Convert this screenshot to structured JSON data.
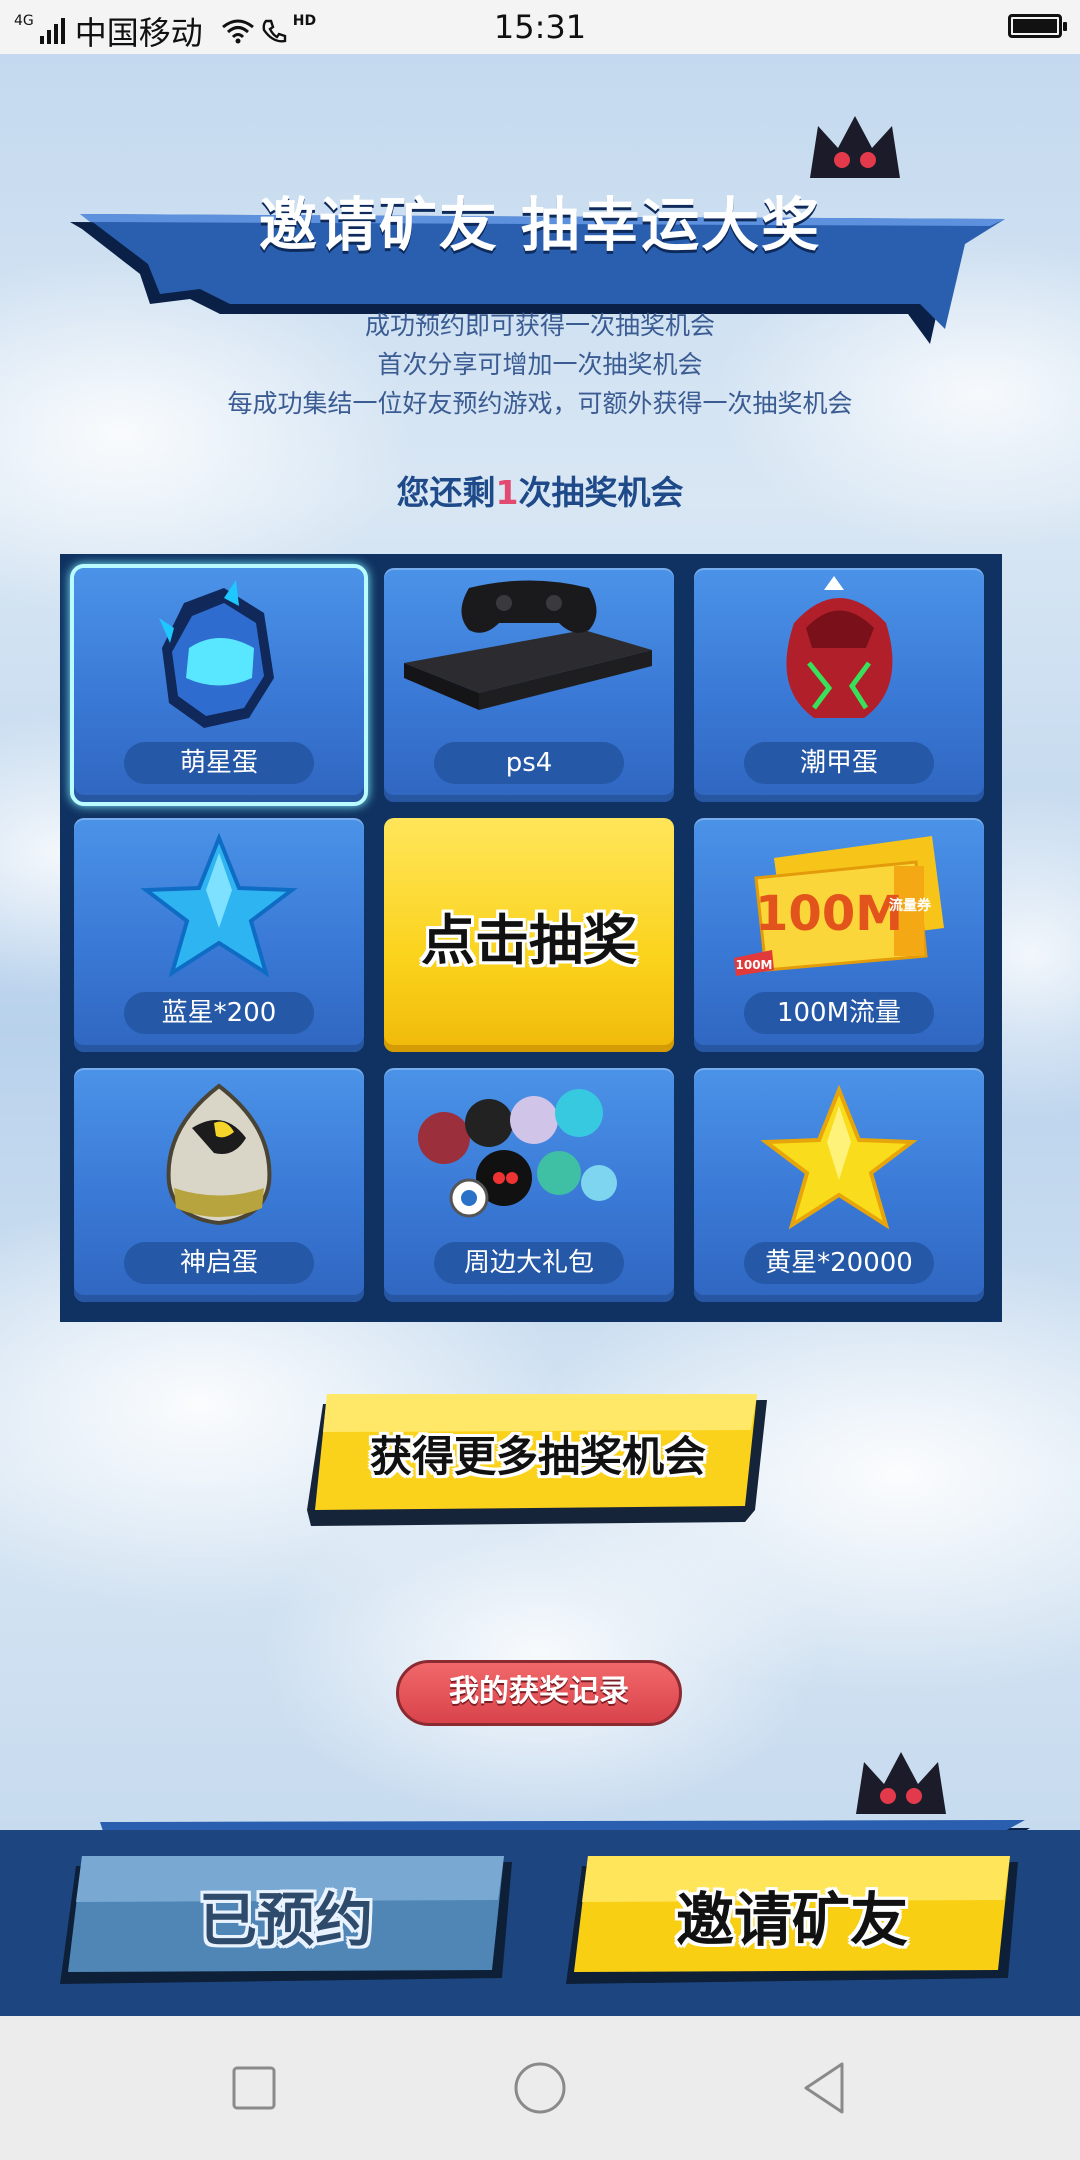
{
  "status_bar": {
    "network": "4G",
    "carrier": "中国移动",
    "hd": "HD",
    "time": "15:31"
  },
  "page": {
    "title": "邀请矿友 抽幸运大奖",
    "intro": [
      "成功预约即可获得一次抽奖机会",
      "首次分享可增加一次抽奖机会",
      "每成功集结一位好友预约游戏，可额外获得一次抽奖机会"
    ],
    "chances_prefix": "您还剩",
    "chances_count": "1",
    "chances_suffix": "次抽奖机会"
  },
  "lottery": {
    "draw_label": "点击抽奖",
    "prizes": [
      {
        "label": "萌星蛋",
        "icon": "cute-star-egg-icon",
        "selected": true
      },
      {
        "label": "ps4",
        "icon": "ps4-console-icon",
        "selected": false
      },
      {
        "label": "潮甲蛋",
        "icon": "trend-armor-egg-icon",
        "selected": false
      },
      {
        "label": "蓝星*200",
        "icon": "blue-star-icon",
        "selected": false
      },
      {
        "label": "100M流量",
        "icon": "data-voucher-icon",
        "selected": false
      },
      {
        "label": "神启蛋",
        "icon": "divine-egg-icon",
        "selected": false
      },
      {
        "label": "周边大礼包",
        "icon": "merch-gift-pack-icon",
        "selected": false
      },
      {
        "label": "黄星*20000",
        "icon": "yellow-star-icon",
        "selected": false
      }
    ],
    "voucher_art": {
      "big": "100M",
      "small": "100M",
      "side": "流量券"
    }
  },
  "buttons": {
    "more_chances": "获得更多抽奖机会",
    "my_records": "我的获奖记录",
    "reserved": "已预约",
    "invite": "邀请矿友"
  },
  "colors": {
    "primary_blue": "#2a5fb0",
    "dark_navy": "#103262",
    "accent_yellow": "#fbd31c",
    "record_red": "#de4b52",
    "count_pink": "#e24a72"
  }
}
